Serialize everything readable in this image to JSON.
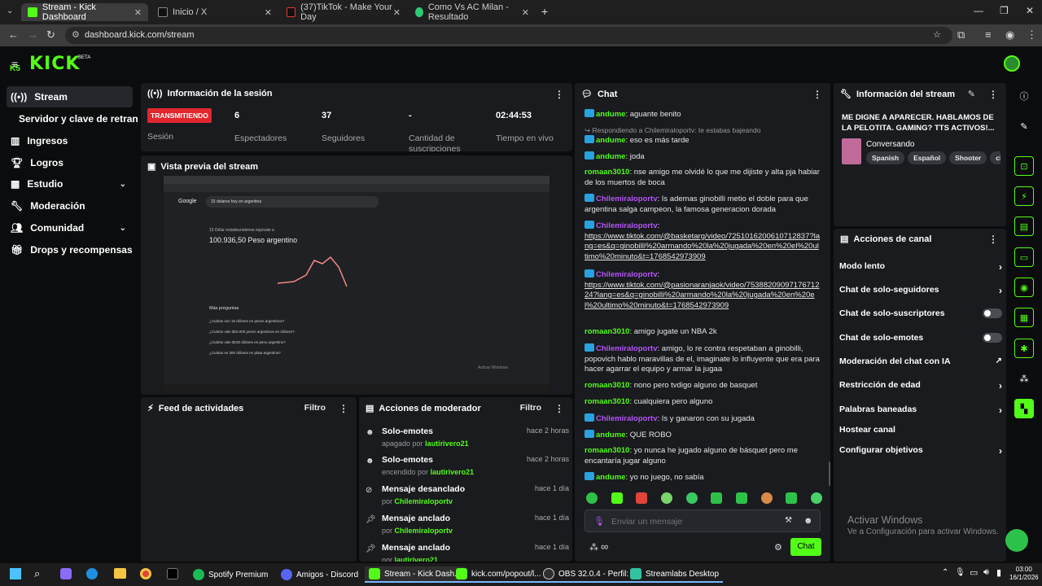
{
  "browser": {
    "tabs": [
      {
        "title": "Stream - Kick Dashboard",
        "icon": "kick-icon",
        "color": "#53fc18"
      },
      {
        "title": "Inicio / X",
        "icon": "x-icon",
        "color": "#ffffff"
      },
      {
        "title": "(37)TikTok - Make Your Day",
        "icon": "tiktok-icon",
        "color": "#000000"
      },
      {
        "title": "Como Vs AC Milan - Resultado",
        "icon": "globe-icon",
        "color": "#2ecc71"
      }
    ],
    "url": "dashboard.kick.com/stream"
  },
  "sidebar": {
    "items": [
      {
        "label": "Stream",
        "icon": "broadcast-icon"
      },
      {
        "label": "Servidor y clave de retransm",
        "icon": ""
      },
      {
        "label": "Ingresos",
        "icon": "chart-icon"
      },
      {
        "label": "Logros",
        "icon": "trophy-icon"
      },
      {
        "label": "Estudio",
        "icon": "grid-icon"
      },
      {
        "label": "Moderación",
        "icon": "wrench-icon"
      },
      {
        "label": "Comunidad",
        "icon": "people-icon"
      },
      {
        "label": "Drops y recompensas",
        "icon": "gift-icon"
      }
    ]
  },
  "session": {
    "title": "Información de la sesión",
    "live_badge": "TRANSMITIENDO",
    "session_label": "Sesión",
    "stats": [
      {
        "value": "6",
        "label": "Espectadores"
      },
      {
        "value": "37",
        "label": "Seguidores"
      },
      {
        "value": "-",
        "label": "Cantidad de suscripciones"
      },
      {
        "value": "02:44:53",
        "label": "Tiempo en vivo"
      }
    ]
  },
  "preview": {
    "title": "Vista previa del stream",
    "inner": {
      "search_text": "15 dolares hoy en argentina",
      "result_small": "15 Dólar estadounidense equivale a",
      "result_big": "100.936,50 Peso argentino",
      "more_label": "Más preguntas",
      "questions": [
        "¿Cuánto son 15 dólares en pesos argentinos?",
        "¿Cuánto vale $15.000 pesos argentinos en dólares?",
        "¿Cuánto vale $100 dólares en peso argentino?",
        "¿Cuánto es 300 dólares en plata argentina?"
      ],
      "watermark": "Activar Windows"
    }
  },
  "activity": {
    "title": "Feed de actividades",
    "filter": "Filtro"
  },
  "modactions": {
    "title": "Acciones de moderador",
    "filter": "Filtro",
    "items": [
      {
        "title": "Solo-emotes",
        "sub": "apagado por",
        "user": "lautirivero21",
        "time": "hace 2 horas",
        "icon": "emote-icon"
      },
      {
        "title": "Solo-emotes",
        "sub": "encendido por",
        "user": "lautirivero21",
        "time": "hace 2 horas",
        "icon": "emote-icon"
      },
      {
        "title": "Mensaje desanclado",
        "sub": "por",
        "user": "Chilemiraloportv",
        "time": "hace 1 día",
        "icon": "unpin-icon"
      },
      {
        "title": "Mensaje anclado",
        "sub": "por",
        "user": "Chilemiraloportv",
        "time": "hace 1 día",
        "icon": "pin-icon"
      },
      {
        "title": "Mensaje anclado",
        "sub": "por",
        "user": "lautirivero21",
        "time": "hace 1 día",
        "icon": "pin-icon"
      }
    ]
  },
  "chat": {
    "title": "Chat",
    "messages": [
      {
        "user": "andume",
        "color": "#53fc18",
        "text": "aguante benito",
        "badge": true
      },
      {
        "reply": "Respondiendo a Chilemiraloportv: te estabas bajeando"
      },
      {
        "user": "andume",
        "color": "#53fc18",
        "text": "eso es más tarde",
        "badge": true
      },
      {
        "user": "andume",
        "color": "#53fc18",
        "text": "joda",
        "badge": true
      },
      {
        "user": "romaan3010",
        "color": "#53fc18",
        "text": "nse amigo me olvidé lo que me dijiste y alta pja habiar de los muertos de boca",
        "badge": false
      },
      {
        "user": "Chilemiraloportv",
        "color": "#b455f5",
        "text": "Is ademas ginobilli metio el doble para que argentina salga campeon, la famosa generacion dorada",
        "badge": true
      },
      {
        "user": "Chilemiraloportv",
        "color": "#b455f5",
        "text": "",
        "link": "https://www.tiktok.com/@basketarg/video/7251016200610712837?lang=es&q=ginobilli%20armando%20la%20jugada%20en%20el%20ultimo%20minuto&t=1768542973909",
        "badge": true
      },
      {
        "user": "Chilemiraloportv",
        "color": "#b455f5",
        "text": "",
        "link": "https://www.tiktok.com/@pasionaranjaok/video/7538820909717671224?lang=es&q=ginobilli%20armando%20la%20jugada%20en%20el%20ultimo%20minuto&t=1768542973909",
        "badge": true
      },
      {
        "user": "romaan3010",
        "color": "#53fc18",
        "text": "amigo jugate un NBA 2k",
        "badge": false
      },
      {
        "user": "Chilemiraloportv",
        "color": "#b455f5",
        "text": "amigo, lo re contra respetaban a ginobilli, popovich hablo maravillas de el, imaginate lo influyente que era para hacer agarrar el equipo y armar la jugaa",
        "badge": true
      },
      {
        "user": "romaan3010",
        "color": "#53fc18",
        "text": "nono pero tvdigo alguno de basquet",
        "badge": false
      },
      {
        "user": "romaan3010",
        "color": "#53fc18",
        "text": "cualquiera pero alguno",
        "badge": false
      },
      {
        "user": "Chilemiraloportv",
        "color": "#b455f5",
        "text": "Is y ganaron con su jugada",
        "badge": true
      },
      {
        "user": "andume",
        "color": "#53fc18",
        "text": "QUE ROBO",
        "badge": true
      },
      {
        "user": "romaan3010",
        "color": "#53fc18",
        "text": "yo nunca he jugado alguno de básquet pero me encantaría jugar alguno",
        "badge": false
      },
      {
        "user": "andume",
        "color": "#53fc18",
        "text": "yo no juego, no sabía",
        "badge": true
      }
    ],
    "input_placeholder": "Enviar un mensaje",
    "send_label": "Chat",
    "infinity": "∞"
  },
  "streaminfo": {
    "title": "Información del stream",
    "stream_title": "ME DIGNE A APARECER. HABLAMOS DE LA PELOTITA. GAMING? TTS ACTIVOS!...",
    "category": "Conversando",
    "tags": [
      "Spanish",
      "Español",
      "Shooter",
      "chill"
    ]
  },
  "channel_actions": {
    "title": "Acciones de canal",
    "items": [
      {
        "label": "Modo lento",
        "kind": "arrow"
      },
      {
        "label": "Chat de solo-seguidores",
        "kind": "arrow"
      },
      {
        "label": "Chat de solo-suscriptores",
        "kind": "toggle"
      },
      {
        "label": "Chat de solo-emotes",
        "kind": "toggle"
      },
      {
        "label": "Moderación del chat con IA",
        "kind": "external"
      },
      {
        "label": "Restricción de edad",
        "kind": "arrow"
      },
      {
        "label": "Palabras baneadas",
        "kind": "arrow"
      },
      {
        "label": "Hostear canal",
        "kind": "none"
      },
      {
        "label": "Configurar objetivos",
        "kind": "arrow"
      }
    ]
  },
  "watermark": {
    "line1": "Activar Windows",
    "line2": "Ve a Configuración para activar Windows."
  },
  "taskbar": {
    "apps": [
      {
        "label": "Spotify Premium",
        "color": "#1db954"
      },
      {
        "label": "Amigos - Discord",
        "color": "#5865f2"
      },
      {
        "label": "Stream - Kick Dash...",
        "color": "#53fc18"
      },
      {
        "label": "kick.com/popout/l...",
        "color": "#53fc18"
      },
      {
        "label": "OBS 32.0.4 - Perfil: ...",
        "color": "#302e31"
      },
      {
        "label": "Streamlabs Desktop",
        "color": "#31c3a2"
      }
    ],
    "time": "03:00",
    "date": "16/1/2026"
  }
}
